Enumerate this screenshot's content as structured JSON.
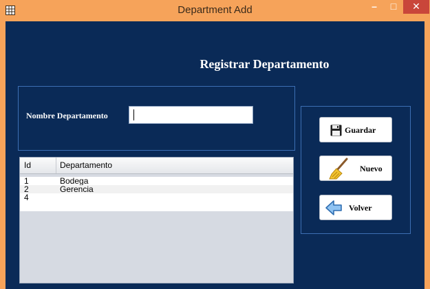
{
  "window": {
    "title": "Department Add",
    "minimize_glyph": "–",
    "maximize_glyph": "□",
    "close_glyph": "✕"
  },
  "form": {
    "heading": "Registrar Departamento",
    "nombre_label": "Nombre Departamento",
    "nombre_value": ""
  },
  "table": {
    "columns": [
      "Id",
      "Departamento"
    ],
    "rows": [
      {
        "id": "1",
        "departamento": "Bodega"
      },
      {
        "id": "2",
        "departamento": "Gerencia"
      },
      {
        "id": "4",
        "departamento": ""
      }
    ]
  },
  "buttons": {
    "guardar": {
      "label": "Guardar",
      "icon": "floppy-disk-icon"
    },
    "nuevo": {
      "label": "Nuevo",
      "icon": "broom-icon"
    },
    "volver": {
      "label": "Volver",
      "icon": "arrow-left-icon"
    }
  },
  "colors": {
    "titlebar": "#f6a35a",
    "client": "#0a2a57",
    "close": "#c9463a"
  }
}
